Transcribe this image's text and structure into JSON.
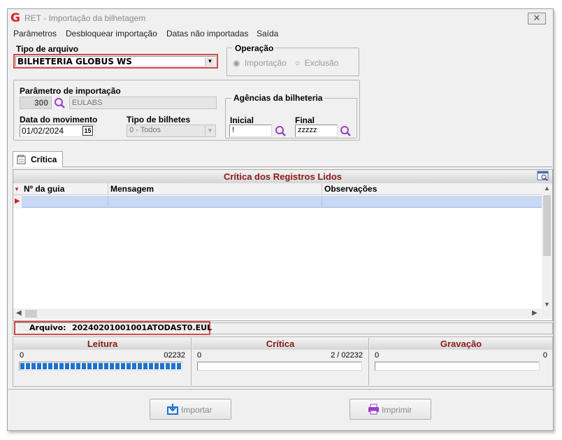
{
  "window": {
    "logo": "G",
    "title": "RET - Importação da bilhetagem",
    "close": "✕"
  },
  "menu": {
    "items": [
      "Parâmetros",
      "Desbloquear importação",
      "Datas não importadas",
      "Saída"
    ]
  },
  "file_type": {
    "label": "Tipo de arquivo",
    "value": "BILHETERIA GLOBUS WS"
  },
  "operation": {
    "label": "Operação",
    "options": [
      "Importação",
      "Exclusão"
    ],
    "selected": "Importação"
  },
  "import_param": {
    "label": "Parâmetro de importação",
    "code": "300",
    "name": "EULABS"
  },
  "movement_date": {
    "label": "Data do movimento",
    "value": "01/02/2024",
    "calendar_text": "15"
  },
  "ticket_type": {
    "label": "Tipo de bilhetes",
    "value": "0 - Todos"
  },
  "agencies": {
    "label": "Agências da bilheteria",
    "initial_label": "Inicial",
    "initial_value": "!",
    "final_label": "Final",
    "final_value": "zzzzz"
  },
  "tabs": {
    "critica": "Crítica"
  },
  "grid": {
    "title": "Crítica dos Registros Lidos",
    "columns": [
      "Nº da guia",
      "Mensagem",
      "Observações"
    ]
  },
  "file_status": {
    "label": "Arquivo:",
    "filename": "20240201001001ATODAST0.EUL"
  },
  "progress": {
    "reading": {
      "title": "Leitura",
      "start": "0",
      "end": "02232",
      "fraction": 1.0
    },
    "critique": {
      "title": "Crítica",
      "start": "0",
      "end": "2 / 02232",
      "fraction": 0.0
    },
    "recording": {
      "title": "Gravação",
      "start": "0",
      "end": "0",
      "fraction": 0.0
    }
  },
  "buttons": {
    "import": "Importar",
    "print": "Imprimir"
  },
  "colors": {
    "accent_red": "#d44a4a",
    "section_title": "#8b1a1a",
    "progress_blue": "#1e73cf",
    "selected_row": "#c8d8f5",
    "lens_purple": "#9b3fc8"
  }
}
